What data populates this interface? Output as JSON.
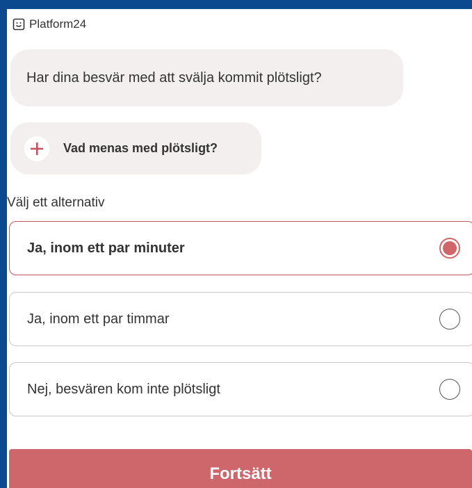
{
  "brand": {
    "name": "Platform24",
    "icon": "smiley-chat-icon"
  },
  "question": {
    "text": "Har dina besvär med att svälja kommit plötsligt?"
  },
  "info": {
    "label": "Vad menas med plötsligt?",
    "icon": "plus-icon"
  },
  "choose_label": "Välj ett alternativ",
  "options": [
    {
      "label": "Ja, inom ett par minuter",
      "selected": true
    },
    {
      "label": "Ja, inom ett par timmar",
      "selected": false
    },
    {
      "label": "Nej, besvären kom inte plötsligt",
      "selected": false
    }
  ],
  "continue_label": "Fortsätt",
  "colors": {
    "frame": "#0b4a8f",
    "accent": "#d06669",
    "button": "#cd676c",
    "bubble": "#f3efee"
  }
}
